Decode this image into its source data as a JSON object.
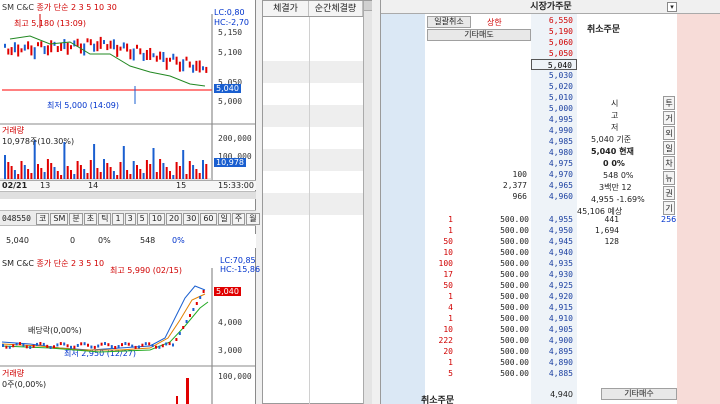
{
  "chart1": {
    "title": "SM C&C",
    "title_suffix": "종가 단순 2 3 5 10 30",
    "hl_lc": "LC:0,80",
    "hl_hc": "HC:-2,70",
    "high_label": "최고 5,180 (13:09)",
    "low_label": "최저 5,000 (14:09)",
    "price_axis": [
      "5,150",
      "5,100",
      "5,050",
      "5,000"
    ],
    "current_price": "5,040",
    "volume_title": "거래량",
    "volume_label": "10,978주(10.30%)",
    "volume_axis": [
      "200,000",
      "100,000"
    ],
    "current_volume": "10,978",
    "date_axis": [
      "02/21",
      "13",
      "14",
      "15",
      "15:33:00"
    ]
  },
  "toolbar": {
    "code": "048550",
    "items": [
      "코",
      "SM",
      "분",
      "초",
      "틱",
      "1",
      "3",
      "5",
      "10",
      "20",
      "30",
      "60",
      "일",
      "주",
      "월"
    ]
  },
  "quote_row": {
    "price": "5,040",
    "change": "0",
    "pct": "0%",
    "volume": "548",
    "rate": "0%"
  },
  "chart2": {
    "title": "SM C&C",
    "title_suffix": "종가 단순 2 3 5 10",
    "hl_lc": "LC:70,85",
    "hl_hc": "HC:-15,86",
    "high_label": "최고 5,990 (02/15)",
    "low_label": "최저 2,950 (12/27)",
    "dividend_label": "배당락(0,00%)",
    "price_axis": [
      "4,000",
      "3,000"
    ],
    "current_price": "5,040",
    "volume_title": "거래량",
    "volume_label": "0주(0,00%)",
    "volume_axis": [
      "100,000"
    ]
  },
  "middle": {
    "col1": "체결가",
    "col2": "순간체결량"
  },
  "order": {
    "title": "시장가주문",
    "btn_cancel_all": "일괄취소",
    "upper_limit": "상한",
    "other_sell": "기타매도",
    "cancel_order": "취소주문",
    "other_buy": "기타매수",
    "ask_prices": [
      "6,550",
      "5,190",
      "5,060",
      "5,050",
      "5,040",
      "5,030",
      "5,020",
      "5,010",
      "5,000",
      "4,995",
      "4,990",
      "4,985",
      "4,980",
      "4,975",
      "4,970",
      "4,965",
      "4,960"
    ],
    "ask_qty": [
      "",
      "",
      "",
      "",
      "",
      "",
      "",
      "",
      "",
      "",
      "",
      "",
      "",
      "",
      "100",
      "2,377",
      "966"
    ],
    "bid_rows": [
      {
        "cnt": "1",
        "amt": "500.00",
        "price": "4,955"
      },
      {
        "cnt": "1",
        "amt": "500.00",
        "price": "4,950"
      },
      {
        "cnt": "50",
        "amt": "500.00",
        "price": "4,945"
      },
      {
        "cnt": "10",
        "amt": "500.00",
        "price": "4,940"
      },
      {
        "cnt": "100",
        "amt": "500.00",
        "price": "4,935"
      },
      {
        "cnt": "17",
        "amt": "500.00",
        "price": "4,930"
      },
      {
        "cnt": "50",
        "amt": "500.00",
        "price": "4,925"
      },
      {
        "cnt": "1",
        "amt": "500.00",
        "price": "4,920"
      },
      {
        "cnt": "4",
        "amt": "500.00",
        "price": "4,915"
      },
      {
        "cnt": "1",
        "amt": "500.00",
        "price": "4,910"
      },
      {
        "cnt": "10",
        "amt": "500.00",
        "price": "4,905"
      },
      {
        "cnt": "222",
        "amt": "500.00",
        "price": "4,900"
      },
      {
        "cnt": "20",
        "amt": "500.00",
        "price": "4,895"
      },
      {
        "cnt": "1",
        "amt": "500.00",
        "price": "4,890"
      },
      {
        "cnt": "5",
        "amt": "500.00",
        "price": "4,885"
      }
    ],
    "bid_qty": [
      "441",
      "1,694",
      "128"
    ],
    "bottom_price": "4,940",
    "info": {
      "l1": "시",
      "l2": "고",
      "l3": "저",
      "base": "5,040 기준",
      "cur": "5,040 현재",
      "pct": "0 0%",
      "pct2": "0%",
      "vol": "548 0%",
      "amt": "3백만 12",
      "change": "4,955 -1.69%",
      "expected": "45,106 예상",
      "side": [
        "투",
        "거",
        "외",
        "일",
        "차",
        "뉴",
        "권",
        "기"
      ],
      "extra": "256"
    }
  }
}
